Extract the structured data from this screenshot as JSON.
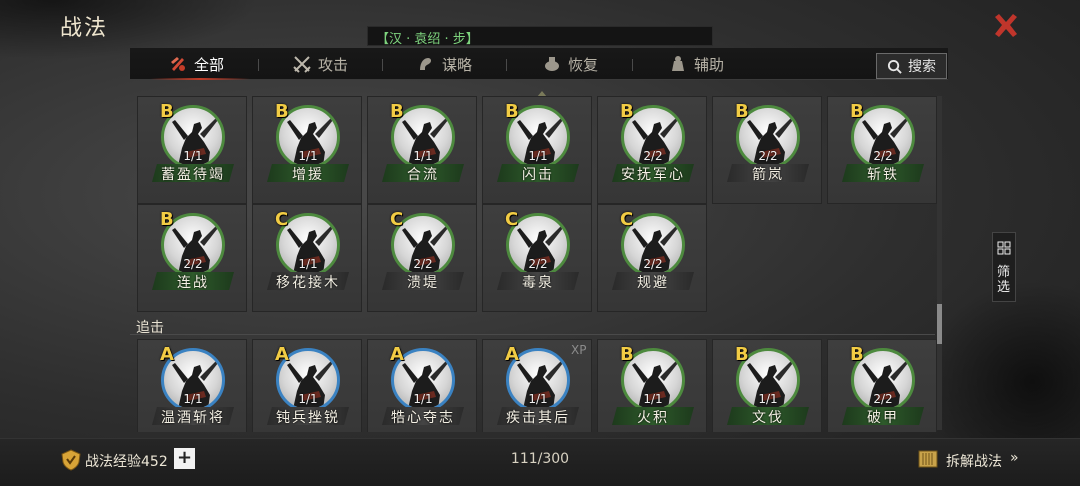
{
  "header": {
    "title": "战法",
    "faction_label": "【汉 · 袁绍 · 步】"
  },
  "tabs": [
    {
      "label": "全部",
      "icon": "all-skills-icon",
      "active": true
    },
    {
      "label": "攻击",
      "icon": "crossed-swords-icon",
      "active": false
    },
    {
      "label": "谋略",
      "icon": "strategy-icon",
      "active": false
    },
    {
      "label": "恢复",
      "icon": "recovery-icon",
      "active": false
    },
    {
      "label": "辅助",
      "icon": "support-icon",
      "active": false
    }
  ],
  "search": {
    "label": "搜索",
    "icon": "search-icon"
  },
  "sections": [
    {
      "label": "",
      "cards": [
        {
          "grade": "B",
          "count": "1/1",
          "name": "蓄盈待竭",
          "bar": "green"
        },
        {
          "grade": "B",
          "count": "1/1",
          "name": "增援",
          "bar": "green"
        },
        {
          "grade": "B",
          "count": "1/1",
          "name": "合流",
          "bar": "green"
        },
        {
          "grade": "B",
          "count": "1/1",
          "name": "闪击",
          "bar": "green"
        },
        {
          "grade": "B",
          "count": "2/2",
          "name": "安抚军心",
          "bar": "green"
        },
        {
          "grade": "B",
          "count": "2/2",
          "name": "箭岚",
          "bar": "gray"
        },
        {
          "grade": "B",
          "count": "2/2",
          "name": "斩铁",
          "bar": "green"
        },
        {
          "grade": "B",
          "count": "2/2",
          "name": "连战",
          "bar": "green"
        },
        {
          "grade": "C",
          "count": "1/1",
          "name": "移花接木",
          "bar": "gray"
        },
        {
          "grade": "C",
          "count": "2/2",
          "name": "溃堤",
          "bar": "gray"
        },
        {
          "grade": "C",
          "count": "2/2",
          "name": "毒泉",
          "bar": "gray"
        },
        {
          "grade": "C",
          "count": "2/2",
          "name": "规避",
          "bar": "gray"
        }
      ]
    },
    {
      "label": "追击",
      "cards": [
        {
          "grade": "A",
          "count": "1/1",
          "name": "温酒斩将",
          "bar": "gray",
          "ring": "blue"
        },
        {
          "grade": "A",
          "count": "1/1",
          "name": "钝兵挫锐",
          "bar": "gray",
          "ring": "blue"
        },
        {
          "grade": "A",
          "count": "1/1",
          "name": "牿心夺志",
          "bar": "gray",
          "ring": "blue"
        },
        {
          "grade": "A",
          "count": "1/1",
          "name": "疾击其后",
          "bar": "gray",
          "ring": "blue",
          "xp": "XP"
        },
        {
          "grade": "B",
          "count": "1/1",
          "name": "火积",
          "bar": "green"
        },
        {
          "grade": "B",
          "count": "1/1",
          "name": "文伐",
          "bar": "green"
        },
        {
          "grade": "B",
          "count": "2/2",
          "name": "破甲",
          "bar": "green"
        }
      ]
    }
  ],
  "filter": {
    "label": "筛选",
    "icon": "filter-grid-icon"
  },
  "footer": {
    "exp_label": "战法经验452",
    "exp_icon": "shield-badge-icon",
    "plus_label": "+",
    "capacity": "111/300",
    "disassemble_label": "拆解战法",
    "disassemble_icon": "scroll-icon"
  },
  "colors": {
    "grade_gold": "#f2cc44",
    "ring_green": "#4d8a3e",
    "ring_blue": "#3a82c2",
    "close_red": "#c0352b",
    "faction_text": "#7ed47e"
  }
}
